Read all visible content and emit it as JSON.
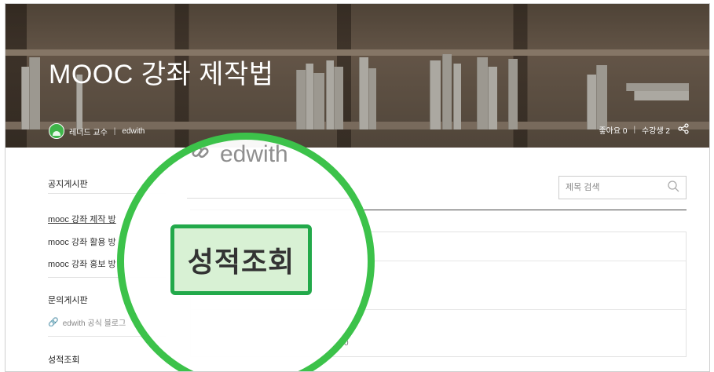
{
  "header": {
    "title": "MOOC 강좌 제작법",
    "author": "레너드 교수",
    "separator": "|",
    "org": "edwith",
    "likes_label": "좋아요 0",
    "stats_sep": "|",
    "students_label": "수강생 2",
    "share_icon": "share-icon"
  },
  "sidebar": {
    "notice_board": "공지게시판",
    "items": [
      {
        "label": "mooc 강좌 제작 방"
      },
      {
        "label": "mooc 강좌 활용 방"
      },
      {
        "label": "mooc 강좌 홍보 방"
      }
    ],
    "qa_board": "문의게시판",
    "blog_link": "edwith 공식 블로그",
    "grades": "성적조회"
  },
  "main": {
    "logo_text": "edwith",
    "search": {
      "placeholder": "제목 검색"
    },
    "count_text": "0"
  },
  "callout": {
    "label": "성적조회",
    "ring_color": "#3cc24a",
    "box_color": "#22a94a",
    "box_fill": "#d8f1d4"
  }
}
